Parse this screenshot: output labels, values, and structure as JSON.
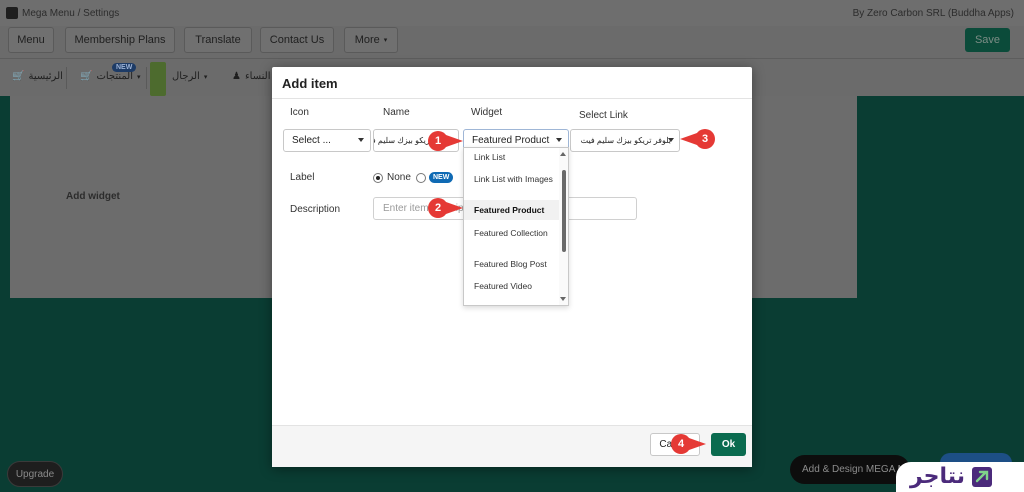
{
  "app": {
    "breadcrumb": "Mega Menu / Settings",
    "byline": "By Zero Carbon SRL (Buddha Apps)",
    "nav_buttons": [
      "Menu",
      "Membership Plans",
      "Translate",
      "Contact Us",
      "More"
    ],
    "save_label": "Save",
    "menu_items": [
      "الرئيسية",
      "المنتجات",
      "الرجال",
      "النساء"
    ],
    "new_tag": "NEW",
    "add_widget_label": "Add widget",
    "upgrade_label": "Upgrade",
    "design_label": "Add & Design MEGA MENU"
  },
  "modal": {
    "title": "Add item",
    "columns": {
      "icon": "Icon",
      "name": "Name",
      "widget": "Widget",
      "select_link": "Select Link"
    },
    "icon_select_value": "Select ...",
    "name_value": "بلوفر تريكو بيزك سليم فيت",
    "widget_select_value": "Featured Product",
    "link_select_value": "بلوفر تريكو بيزك سليم فيت",
    "label_row": "Label",
    "label_options": {
      "none": "None",
      "new": "NEW",
      "selected": "None"
    },
    "description_row": "Description",
    "description_placeholder": "Enter item description",
    "dropdown_options": [
      "Link List",
      "Link List with Images",
      "Featured Product",
      "Featured Collection",
      "Featured Blog Post",
      "Featured Video"
    ],
    "dropdown_selected": "Featured Product",
    "cancel_label": "Cancel",
    "ok_label": "Ok"
  },
  "markers": [
    "1",
    "2",
    "3",
    "4"
  ],
  "brand": {
    "text": "نتاجر"
  },
  "colors": {
    "marker": "#e53935",
    "ok_button": "#0a6b4f",
    "brand": "#4b2a7b",
    "new_badge": "#0f6ab4"
  }
}
